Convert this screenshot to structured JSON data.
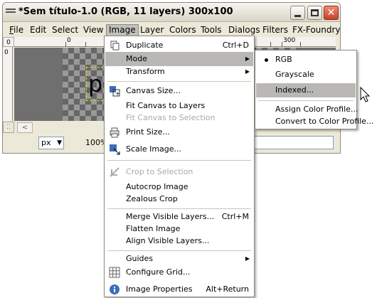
{
  "window": {
    "title": "*Sem título-1.0 (RGB, 11 layers) 300x100",
    "close_glyph": "✕"
  },
  "menubar": {
    "items": [
      "File",
      "Edit",
      "Select",
      "View",
      "Image",
      "Layer",
      "Colors",
      "Tools",
      "Dialogs",
      "Filters",
      "FX-Foundry"
    ]
  },
  "ruler": {
    "corner": "0",
    "labels": [
      "0",
      "300"
    ],
    "left_label": "0"
  },
  "canvas": {
    "layer_text": "p"
  },
  "status": {
    "nav_glyph": "⁚⁚",
    "scroll_glyph": "<",
    "unit": "px",
    "zoom": "100%"
  },
  "image_menu": {
    "items": [
      {
        "label": "Duplicate",
        "accel": "Ctrl+D",
        "icon": "duplicate-icon"
      },
      {
        "label": "Mode",
        "submenu": true,
        "highlighted": true
      },
      {
        "label": "Transform",
        "submenu": true
      },
      {
        "label": "Canvas Size...",
        "icon": "canvas-size-icon"
      },
      {
        "label": "Fit Canvas to Layers"
      },
      {
        "label": "Fit Canvas to Selection",
        "disabled": true
      },
      {
        "label": "Print Size...",
        "icon": "print-size-icon"
      },
      {
        "label": "Scale Image...",
        "icon": "scale-image-icon"
      },
      {
        "label": "Crop to Selection",
        "disabled": true,
        "icon": "crop-icon"
      },
      {
        "label": "Autocrop Image"
      },
      {
        "label": "Zealous Crop"
      },
      {
        "label": "Merge Visible Layers...",
        "accel": "Ctrl+M"
      },
      {
        "label": "Flatten Image"
      },
      {
        "label": "Align Visible Layers..."
      },
      {
        "label": "Guides",
        "submenu": true
      },
      {
        "label": "Configure Grid...",
        "icon": "grid-icon"
      },
      {
        "label": "Image Properties",
        "accel": "Alt+Return",
        "icon": "info-icon"
      }
    ]
  },
  "mode_menu": {
    "items": [
      {
        "label": "RGB",
        "checked": true
      },
      {
        "label": "Grayscale"
      },
      {
        "label": "Indexed...",
        "highlighted": true
      },
      {
        "label": "Assign Color Profile..."
      },
      {
        "label": "Convert to Color Profile..."
      }
    ]
  },
  "colors": {
    "highlight": "#b9b8b4",
    "window_bg": "#ece9d8",
    "close_button": "#c8402a"
  }
}
